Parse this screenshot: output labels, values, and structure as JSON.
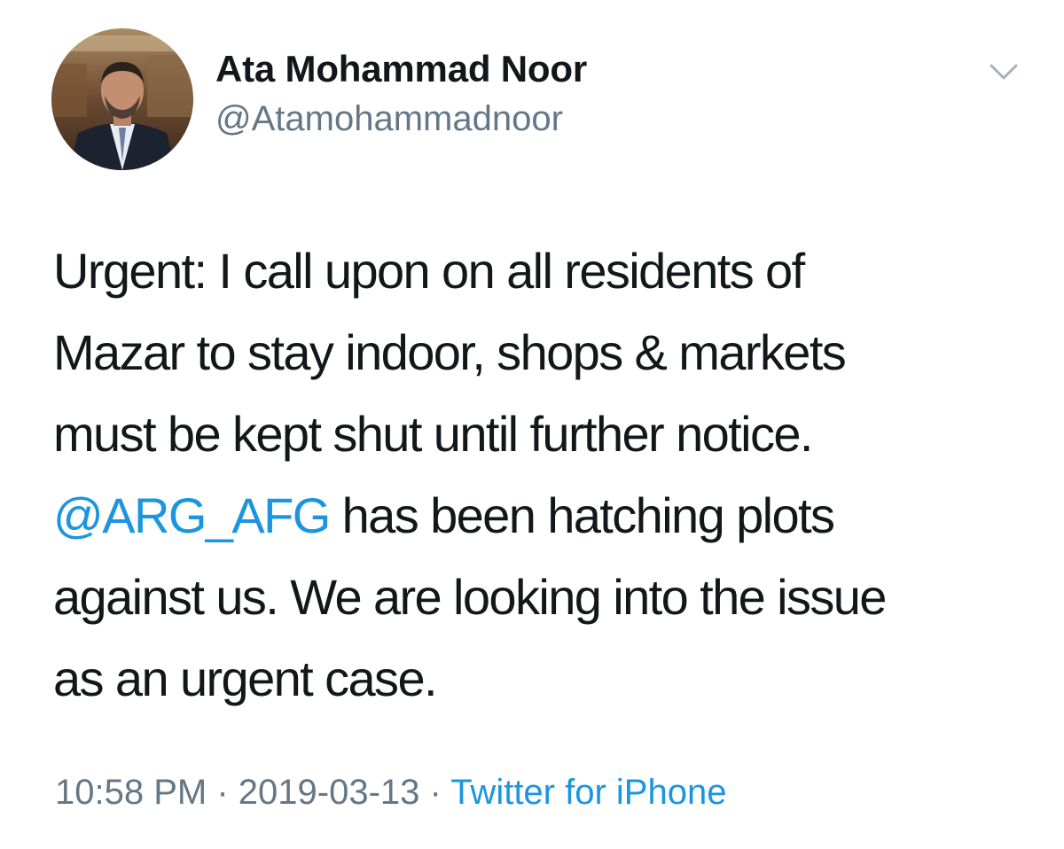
{
  "author": {
    "display_name": "Ata Mohammad Noor",
    "handle": "@Atamohammadnoor"
  },
  "menu_icon": "chevron-down-icon",
  "tweet": {
    "line_1": "Urgent: I call upon on all residents of",
    "line_2": "Mazar to stay indoor, shops & markets",
    "line_3": "must be kept shut until further notice.",
    "mention": "@ARG_AFG",
    "line_4_rest": " has been hatching plots",
    "line_5": "against us. We are looking into the issue",
    "line_6": "as an urgent case."
  },
  "meta": {
    "time": "10:58 PM",
    "separator": " · ",
    "date": "2019-03-13",
    "source": "Twitter for iPhone"
  },
  "colors": {
    "link": "#1b95e0",
    "secondary_text": "#657786",
    "primary_text": "#14171a"
  }
}
